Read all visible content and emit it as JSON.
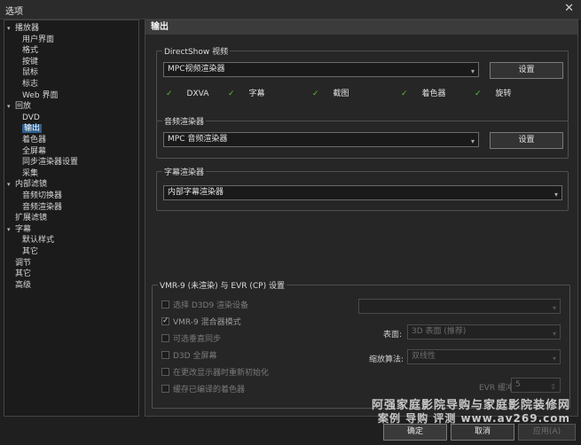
{
  "window": {
    "title": "选项",
    "close": "✕"
  },
  "tree": [
    {
      "label": "播放器",
      "level": 0,
      "arrow": "▾"
    },
    {
      "label": "用户界面",
      "level": 1
    },
    {
      "label": "格式",
      "level": 1
    },
    {
      "label": "按键",
      "level": 1
    },
    {
      "label": "鼠标",
      "level": 1
    },
    {
      "label": "标志",
      "level": 1
    },
    {
      "label": "Web 界面",
      "level": 1
    },
    {
      "label": "回放",
      "level": 0,
      "arrow": "▾"
    },
    {
      "label": "DVD",
      "level": 1
    },
    {
      "label": "输出",
      "level": 1,
      "selected": true
    },
    {
      "label": "着色器",
      "level": 1
    },
    {
      "label": "全屏幕",
      "level": 1
    },
    {
      "label": "同步渲染器设置",
      "level": 1
    },
    {
      "label": "采集",
      "level": 1
    },
    {
      "label": "内部滤镜",
      "level": 0,
      "arrow": "▾"
    },
    {
      "label": "音频切换器",
      "level": 1
    },
    {
      "label": "音频渲染器",
      "level": 1
    },
    {
      "label": "扩展滤镜",
      "level": 0
    },
    {
      "label": "字幕",
      "level": 0,
      "arrow": "▾"
    },
    {
      "label": "默认样式",
      "level": 1
    },
    {
      "label": "其它",
      "level": 1
    },
    {
      "label": "调节",
      "level": 0
    },
    {
      "label": "其它",
      "level": 0
    },
    {
      "label": "高级",
      "level": 0
    }
  ],
  "page": {
    "header": "输出",
    "directshow": {
      "title": "DirectShow 视频",
      "select": "MPC视频渲染器",
      "button": "设置",
      "features": [
        "DXVA",
        "字幕",
        "截图",
        "着色器",
        "旋转"
      ],
      "check_color": "#58c13a"
    },
    "audio": {
      "title": "音频渲染器",
      "select": "MPC 音频渲染器",
      "button": "设置"
    },
    "subtitle": {
      "title": "字幕渲染器",
      "select": "内部字幕渲染器"
    },
    "vmr": {
      "title": "VMR-9 (未渲染) 与 EVR (CP) 设置",
      "options": [
        {
          "label": "选择 D3D9 渲染设备",
          "checked": false
        },
        {
          "label": "VMR-9 混合器模式",
          "checked": true
        },
        {
          "label": "可选垂直同步",
          "checked": false
        },
        {
          "label": "D3D 全屏幕",
          "checked": false
        },
        {
          "label": "在更改显示器时重新初始化",
          "checked": false
        },
        {
          "label": "缓存已编译的着色器",
          "checked": false
        }
      ],
      "device_select": "",
      "surface_label": "表面:",
      "surface_value": "3D 表面 (推荐)",
      "resize_label": "缩放算法:",
      "resize_value": "双线性",
      "evr_label": "EVR 缓冲:",
      "evr_value": "5"
    }
  },
  "footer": {
    "ok": "确定",
    "cancel": "取消",
    "apply": "应用(A)"
  },
  "watermark": {
    "line1": "阿强家庭影院导购与家庭影院装修网",
    "line2": "案例 导购 评测 www.av269.com"
  }
}
